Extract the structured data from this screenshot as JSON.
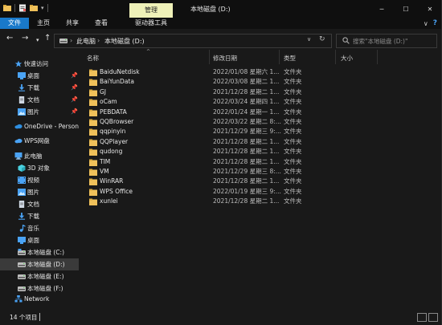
{
  "window": {
    "title": "本地磁盘 (D:)",
    "manage_tab": "管理",
    "controls": [
      "─",
      "☐",
      "✕"
    ]
  },
  "ribbon": {
    "tabs": [
      "文件",
      "主页",
      "共享",
      "查看",
      "驱动器工具"
    ],
    "active_index": 0,
    "help": "?"
  },
  "nav": {
    "back": "←",
    "forward": "→",
    "recent": "▾",
    "up": "↑",
    "breadcrumbs": [
      "此电脑",
      "本地磁盘 (D:)"
    ],
    "separator": "›",
    "search_placeholder": "搜索\"本地磁盘 (D:)\""
  },
  "sidebar": {
    "items": [
      {
        "label": "快速访问",
        "icon": "star-icon",
        "color": "#4aa3f5",
        "pinned": false
      },
      {
        "label": "桌面",
        "icon": "desktop-icon",
        "color": "#4aa3f5",
        "pinned": true
      },
      {
        "label": "下载",
        "icon": "download-icon",
        "color": "#4aa3f5",
        "pinned": true
      },
      {
        "label": "文档",
        "icon": "document-icon",
        "color": "#cfd8e3",
        "pinned": true
      },
      {
        "label": "图片",
        "icon": "pictures-icon",
        "color": "#4aa3f5",
        "pinned": true
      },
      {
        "label": "OneDrive - Personal",
        "icon": "cloud-icon",
        "color": "#2f8fe0",
        "pinned": false
      },
      {
        "label": "WPS网盘",
        "icon": "cloud-icon",
        "color": "#4aa3f5",
        "pinned": false
      },
      {
        "label": "此电脑",
        "icon": "computer-icon",
        "color": "#4aa3f5",
        "pinned": false
      },
      {
        "label": "3D 对象",
        "icon": "cube-icon",
        "color": "#4ad1e0",
        "pinned": false
      },
      {
        "label": "视频",
        "icon": "video-icon",
        "color": "#4aa3f5",
        "pinned": false
      },
      {
        "label": "图片",
        "icon": "pictures-icon",
        "color": "#4aa3f5",
        "pinned": false
      },
      {
        "label": "文档",
        "icon": "document-icon",
        "color": "#cfd8e3",
        "pinned": false
      },
      {
        "label": "下载",
        "icon": "download-icon",
        "color": "#4aa3f5",
        "pinned": false
      },
      {
        "label": "音乐",
        "icon": "music-icon",
        "color": "#4aa3f5",
        "pinned": false
      },
      {
        "label": "桌面",
        "icon": "desktop-icon",
        "color": "#4aa3f5",
        "pinned": false
      },
      {
        "label": "本地磁盘 (C:)",
        "icon": "drive-icon",
        "color": "#bfbfbf",
        "pinned": false
      },
      {
        "label": "本地磁盘 (D:)",
        "icon": "drive-icon",
        "color": "#bfbfbf",
        "pinned": false,
        "selected": true
      },
      {
        "label": "本地磁盘 (E:)",
        "icon": "drive-icon",
        "color": "#bfbfbf",
        "pinned": false
      },
      {
        "label": "本地磁盘 (F:)",
        "icon": "drive-icon",
        "color": "#bfbfbf",
        "pinned": false
      },
      {
        "label": "Network",
        "icon": "network-icon",
        "color": "#4aa3f5",
        "pinned": false
      }
    ]
  },
  "columns": [
    "名称",
    "修改日期",
    "类型",
    "大小"
  ],
  "files": [
    {
      "name": "BaiduNetdisk",
      "date": "2022/01/08 星期六 1...",
      "type": "文件夹"
    },
    {
      "name": "BaiYunData",
      "date": "2022/03/08 星期二 1...",
      "type": "文件夹"
    },
    {
      "name": "GJ",
      "date": "2021/12/28 星期二 1...",
      "type": "文件夹"
    },
    {
      "name": "oCam",
      "date": "2022/03/24 星期四 1...",
      "type": "文件夹"
    },
    {
      "name": "PEBDATA",
      "date": "2022/01/24 星期一 1...",
      "type": "文件夹"
    },
    {
      "name": "QQBrowser",
      "date": "2022/03/22 星期二 8:...",
      "type": "文件夹"
    },
    {
      "name": "qqpinyin",
      "date": "2021/12/29 星期三 9:...",
      "type": "文件夹"
    },
    {
      "name": "QQPlayer",
      "date": "2021/12/28 星期二 1...",
      "type": "文件夹"
    },
    {
      "name": "qudong",
      "date": "2021/12/28 星期二 1...",
      "type": "文件夹"
    },
    {
      "name": "TIM",
      "date": "2021/12/28 星期二 1...",
      "type": "文件夹"
    },
    {
      "name": "VM",
      "date": "2021/12/29 星期三 8:...",
      "type": "文件夹"
    },
    {
      "name": "WinRAR",
      "date": "2021/12/28 星期二 1...",
      "type": "文件夹"
    },
    {
      "name": "WPS Office",
      "date": "2022/01/19 星期三 9:...",
      "type": "文件夹"
    },
    {
      "name": "xunlei",
      "date": "2021/12/28 星期二 1...",
      "type": "文件夹"
    }
  ],
  "status": {
    "count": "14 个项目"
  },
  "colors": {
    "accent": "#1979ca",
    "manage": "#eff1b8",
    "folder": "#f0c15a",
    "background": "#191919"
  }
}
